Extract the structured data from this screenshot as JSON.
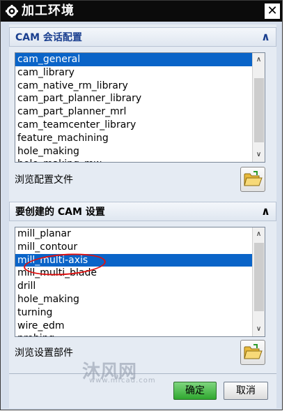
{
  "window": {
    "title": "加工环境",
    "icons": {
      "title": "gear-icon",
      "close": "close-icon"
    }
  },
  "session_section": {
    "title": "CAM 会话配置",
    "items": [
      "cam_general",
      "cam_library",
      "cam_native_rm_library",
      "cam_part_planner_library",
      "cam_part_planner_mrl",
      "cam_teamcenter_library",
      "feature_machining",
      "hole_making",
      "hole_making_mw"
    ],
    "selected": "cam_general",
    "browse_label": "浏览配置文件"
  },
  "setup_section": {
    "title": "要创建的 CAM 设置",
    "items": [
      "mill_planar",
      "mill_contour",
      "mill_multi-axis",
      "mill_multi_blade",
      "drill",
      "hole_making",
      "turning",
      "wire_edm",
      "probing"
    ],
    "selected": "mill_multi-axis",
    "browse_label": "浏览设置部件"
  },
  "buttons": {
    "ok": "确定",
    "cancel": "取消"
  },
  "colors": {
    "titlebar": "#0b0b0b",
    "selection": "#0a64c8",
    "annotation": "#e01010",
    "ok_button": "#3fb33f"
  },
  "watermark": {
    "text": "沐风网",
    "url": "www.mfcad.com"
  }
}
